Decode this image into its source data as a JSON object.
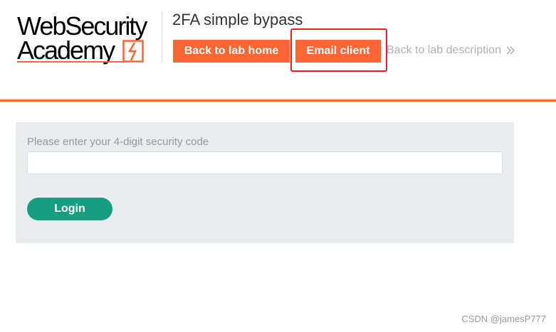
{
  "logo": {
    "line1": "WebSecurity",
    "line2": "Academy"
  },
  "lab": {
    "title": "2FA simple bypass"
  },
  "nav": {
    "back_home": "Back to lab home",
    "email_client": "Email client",
    "back_description": "Back to lab description"
  },
  "form": {
    "label": "Please enter your 4-digit security code",
    "code_value": "",
    "login": "Login"
  },
  "watermark": "CSDN @jamesP777",
  "colors": {
    "brand_orange": "#ff6633",
    "login_green": "#179d80",
    "panel_bg": "#e9edef",
    "highlight_red": "#e8202b"
  }
}
